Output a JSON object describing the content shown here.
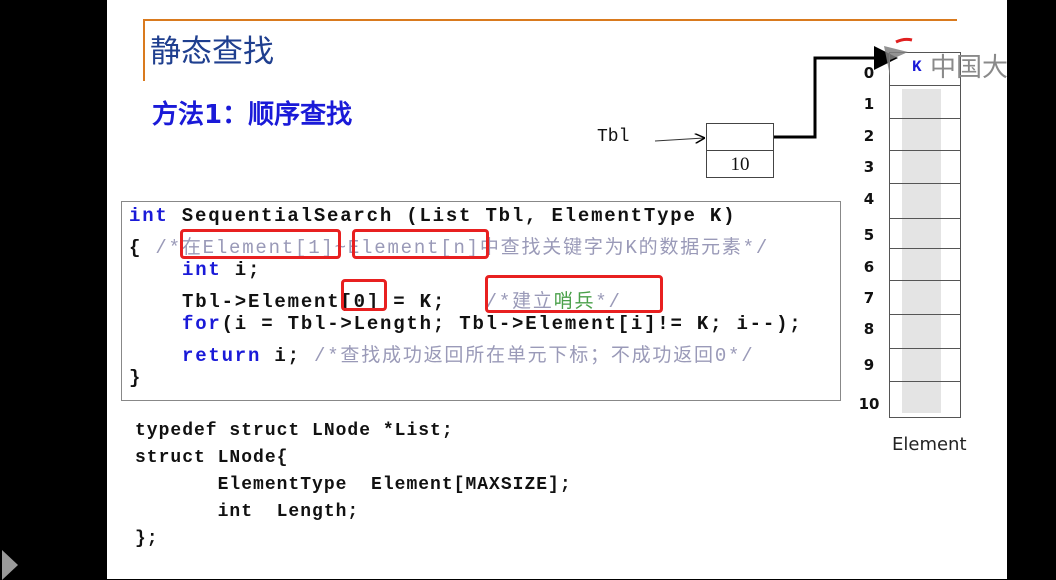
{
  "slide": {
    "title": "静态查找",
    "subtitle": "方法1：顺序查找",
    "code": {
      "l1_kw": "int",
      "l1_rest": " SequentialSearch (List Tbl, ElementType K)",
      "l2_brace": "{ ",
      "l2_c1": "/*",
      "l2_c2": "在Element[1]",
      "l2_c3": "~",
      "l2_c4": "Element[n]",
      "l2_c5": "中查找关键字为K的数据元素*/",
      "l3_kw": "int",
      "l3_rest": " i;",
      "l4_a": "Tbl->Element",
      "l4_b": "[0]",
      "l4_c": " = K;   ",
      "l4_cm1": "/*建立",
      "l4_cm2": "哨兵",
      "l4_cm3": "*/",
      "l5_kw": "for",
      "l5_rest": "(i = Tbl->Length; Tbl->Element[i]!= K; i--);",
      "l6_kw": "return",
      "l6_rest": " i; ",
      "l6_cm": "/*查找成功返回所在单元下标；不成功返回0*/",
      "l7": "}"
    },
    "struct_code": [
      "typedef struct LNode *List;",
      "struct LNode{",
      "       ElementType  Element[MAXSIZE];",
      "       int  Length;",
      "};"
    ],
    "diagram": {
      "tbl_label": "Tbl",
      "tbl_length_value": "10",
      "array_label": "Element",
      "indices": [
        "0",
        "1",
        "2",
        "3",
        "4",
        "5",
        "6",
        "7",
        "8",
        "9",
        "10"
      ],
      "cell0_value": "K"
    },
    "logo_text": "中国大",
    "colors": {
      "title": "#1f3f8f",
      "keyword": "#1a1ad8",
      "highlight_box": "#e82020",
      "accent_line": "#d97a1e"
    }
  },
  "player": {
    "play_icon": "play-icon"
  }
}
